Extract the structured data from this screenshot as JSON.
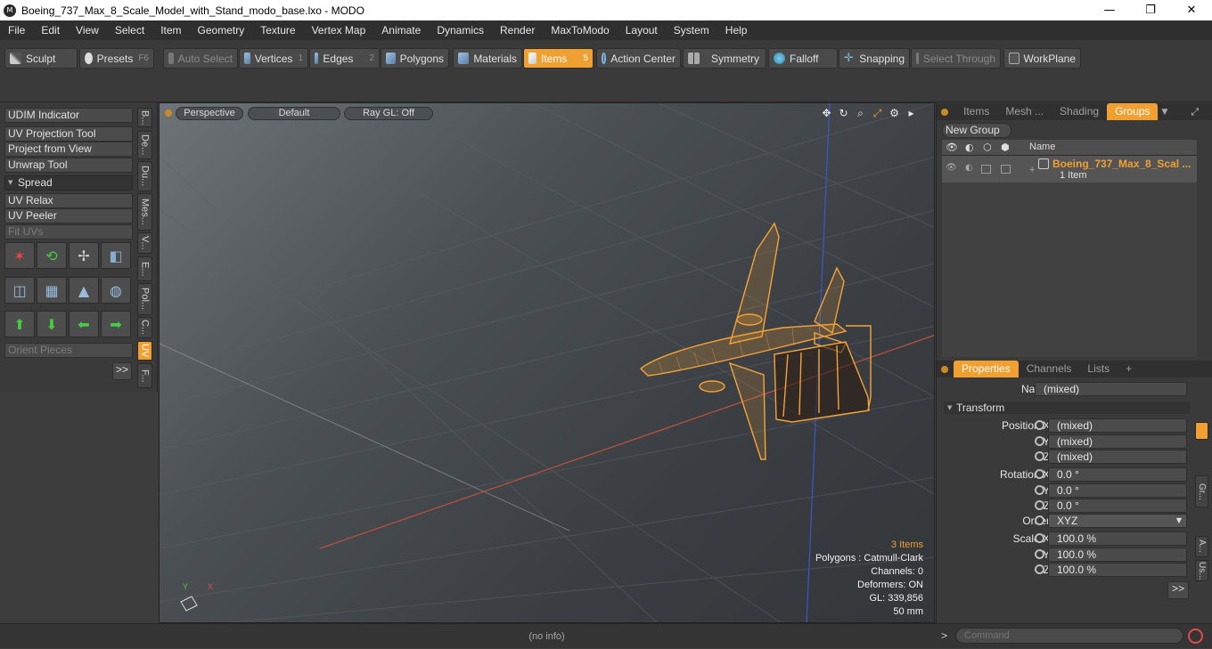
{
  "window": {
    "title": "Boeing_737_Max_8_Scale_Model_with_Stand_modo_base.lxo - MODO",
    "app_icon": "modo-logo-icon",
    "minimize": "—",
    "maximize": "❐",
    "close": "✕"
  },
  "menu": [
    "File",
    "Edit",
    "View",
    "Select",
    "Item",
    "Geometry",
    "Texture",
    "Vertex Map",
    "Animate",
    "Dynamics",
    "Render",
    "MaxToModo",
    "Layout",
    "System",
    "Help"
  ],
  "toolbar": {
    "sculpt": "Sculpt",
    "presets": "Presets",
    "presets_key": "F6",
    "auto_select": "Auto Select",
    "vertices": "Vertices",
    "vertices_key": "1",
    "edges": "Edges",
    "edges_key": "2",
    "polygons": "Polygons",
    "materials": "Materials",
    "items": "Items",
    "items_key": "5",
    "action_center": "Action Center",
    "symmetry": "Symmetry",
    "falloff": "Falloff",
    "snapping": "Snapping",
    "select_through": "Select Through",
    "workplane": "WorkPlane"
  },
  "left_panel": {
    "buttons": [
      "UDIM Indicator",
      "UV Projection Tool",
      "Project from View",
      "Unwrap Tool"
    ],
    "section_spread": "Spread",
    "buttons2": [
      "UV Relax",
      "UV Peeler"
    ],
    "fit_uvs": "Fit UVs",
    "orient_pieces": "Orient Pieces",
    "more": ">>",
    "vertical_tabs": [
      "B...",
      "De...",
      "Du...",
      "Mes...",
      "V...",
      "E...",
      "Pol...",
      "C...",
      "UV",
      "F..."
    ]
  },
  "viewport": {
    "view_mode": "Perspective",
    "shading": "Default",
    "raygl": "Ray GL: Off",
    "info": {
      "items": "3 Items",
      "polygons": "Polygons : Catmull-Clark",
      "channels": "Channels: 0",
      "deformers": "Deformers: ON",
      "gl": "GL: 339,856",
      "focal": "50 mm"
    },
    "axis_x": "X",
    "axis_y": "Y"
  },
  "groups_panel": {
    "tabs": [
      "Items",
      "Mesh ...",
      "Shading",
      "Groups"
    ],
    "active_tab": "Groups",
    "new_group": "New Group",
    "name_col": "Name",
    "group_name": "Boeing_737_Max_8_Scal ...",
    "group_sub": "1 Item"
  },
  "properties": {
    "tabs": [
      "Properties",
      "Channels",
      "Lists"
    ],
    "add": "+",
    "name_label": "Name",
    "name_value": "(mixed)",
    "transform": "Transform",
    "position_x_label": "Position X",
    "position": [
      "(mixed)",
      "(mixed)",
      "(mixed)"
    ],
    "rotation_x_label": "Rotation X",
    "rotation": [
      "0.0 °",
      "0.0 °",
      "0.0 °"
    ],
    "order_label": "Order",
    "order_value": "XYZ",
    "scale_x_label": "Scale X",
    "scale": [
      "100.0 %",
      "100.0 %",
      "100.0 %"
    ],
    "y": "Y",
    "z": "Z",
    "more": ">>",
    "vertical_tabs": [
      "Gr...",
      "A...",
      "Us..."
    ]
  },
  "status": {
    "no_info": "(no info)",
    "command_placeholder": "Command",
    "prompt": ">"
  },
  "colors": {
    "accent": "#f0a030",
    "bg": "#3d3d3d",
    "viewport": "#4b5054"
  }
}
